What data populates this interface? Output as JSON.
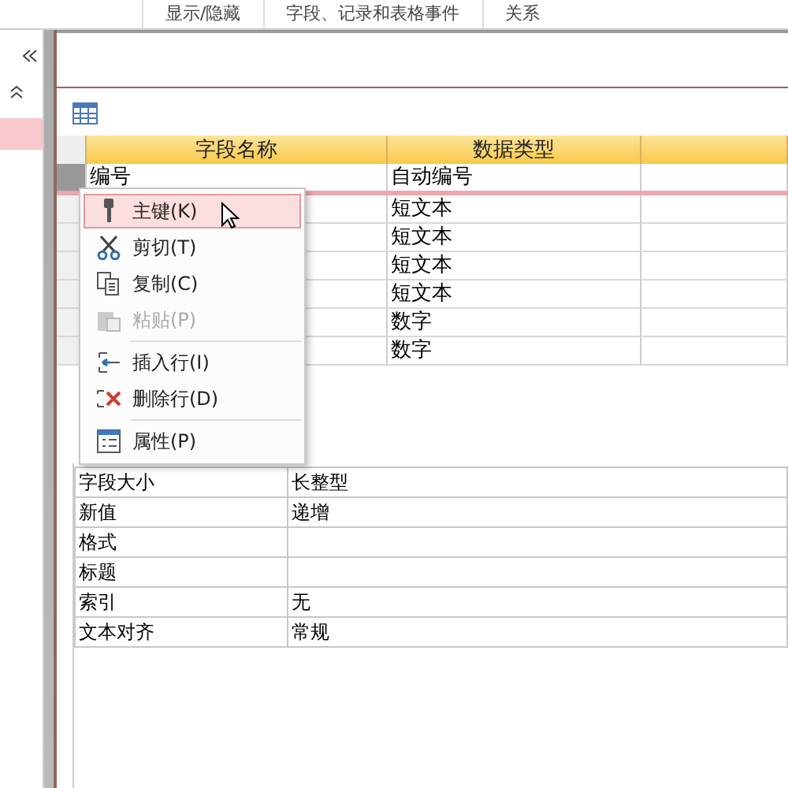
{
  "ribbon_groups": [
    "显示/隐藏",
    "字段、记录和表格事件",
    "关系"
  ],
  "grid": {
    "columns": [
      "字段名称",
      "数据类型"
    ],
    "rows": [
      {
        "field_name": "编号",
        "data_type": "自动编号",
        "selected": true
      },
      {
        "data_type": "短文本",
        "selected": false
      },
      {
        "data_type": "短文本",
        "selected": false
      },
      {
        "data_type": "短文本",
        "selected": false
      },
      {
        "data_type": "短文本",
        "selected": false
      },
      {
        "data_type": "数字",
        "selected": false
      },
      {
        "data_type": "数字",
        "selected": false
      }
    ]
  },
  "context_menu": [
    {
      "label": "主键(K)",
      "selected": true,
      "disabled": false
    },
    {
      "label": "剪切(T)",
      "selected": false,
      "disabled": false
    },
    {
      "label": "复制(C)",
      "selected": false,
      "disabled": false
    },
    {
      "label": "粘贴(P)",
      "selected": false,
      "disabled": true,
      "separator_after": true
    },
    {
      "label": "插入行(I)",
      "selected": false,
      "disabled": false
    },
    {
      "label": "删除行(D)",
      "selected": false,
      "disabled": false,
      "separator_after": true
    },
    {
      "label": "属性(P)",
      "selected": false,
      "disabled": false
    }
  ],
  "properties": [
    {
      "name": "字段大小",
      "value": "长整型"
    },
    {
      "name": "新值",
      "value": "递增"
    },
    {
      "name": "格式"
    },
    {
      "name": "标题"
    },
    {
      "name": "索引",
      "value": "无"
    },
    {
      "name": "文本对齐",
      "value": "常规"
    }
  ]
}
